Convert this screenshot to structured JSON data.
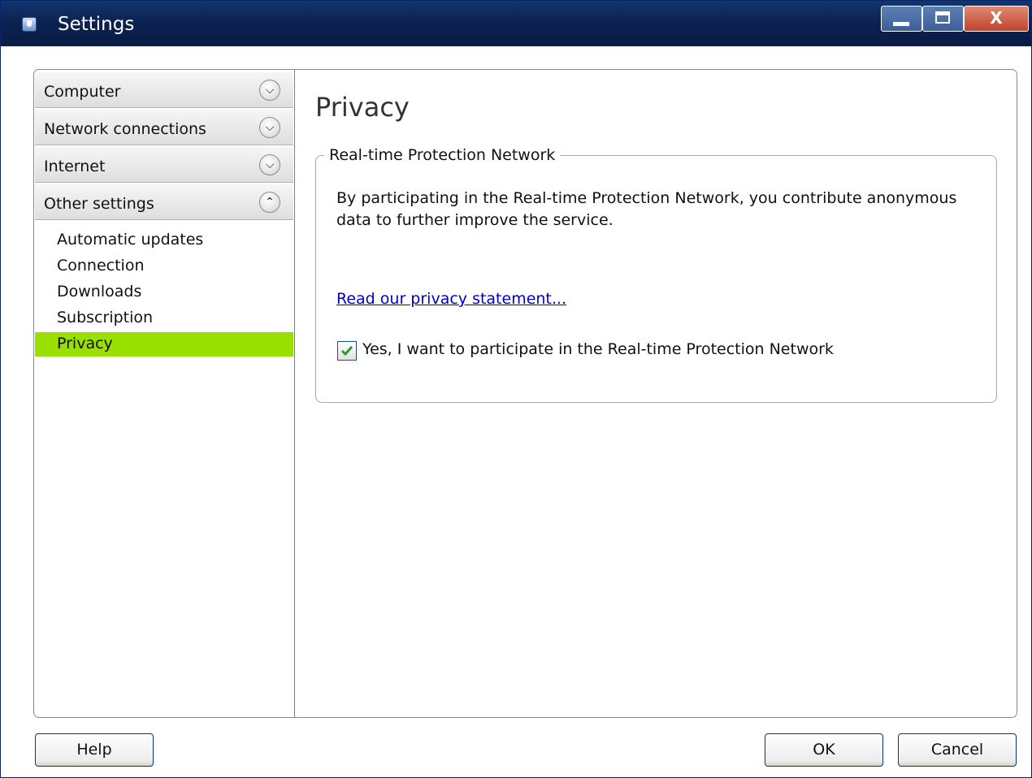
{
  "window": {
    "title": "Settings"
  },
  "titlebar_buttons": {
    "close_glyph": "X"
  },
  "sidebar": {
    "sections": [
      {
        "label": "Computer",
        "expanded": false,
        "chevron": "chevron-down-icon"
      },
      {
        "label": "Network connections",
        "expanded": false,
        "chevron": "chevron-down-icon"
      },
      {
        "label": "Internet",
        "expanded": false,
        "chevron": "chevron-down-icon"
      },
      {
        "label": "Other settings",
        "expanded": true,
        "chevron": "chevron-up-icon"
      }
    ],
    "items": [
      {
        "label": "Automatic updates",
        "selected": false
      },
      {
        "label": "Connection",
        "selected": false
      },
      {
        "label": "Downloads",
        "selected": false
      },
      {
        "label": "Subscription",
        "selected": false
      },
      {
        "label": "Privacy",
        "selected": true
      }
    ],
    "selected_color": "#99e000"
  },
  "main": {
    "title": "Privacy",
    "group": {
      "legend": "Real-time Protection Network",
      "description": "By participating in the Real-time Protection Network, you contribute anonymous data to further improve the service.",
      "link": "Read our privacy statement...",
      "checkbox_label": "Yes, I want to participate in the Real-time Protection Network",
      "checkbox_checked": true
    }
  },
  "footer": {
    "help": "Help",
    "ok": "OK",
    "cancel": "Cancel"
  },
  "colors": {
    "titlebar": "#0b2150",
    "link": "#0000cc",
    "check": "#2b9a2b"
  }
}
